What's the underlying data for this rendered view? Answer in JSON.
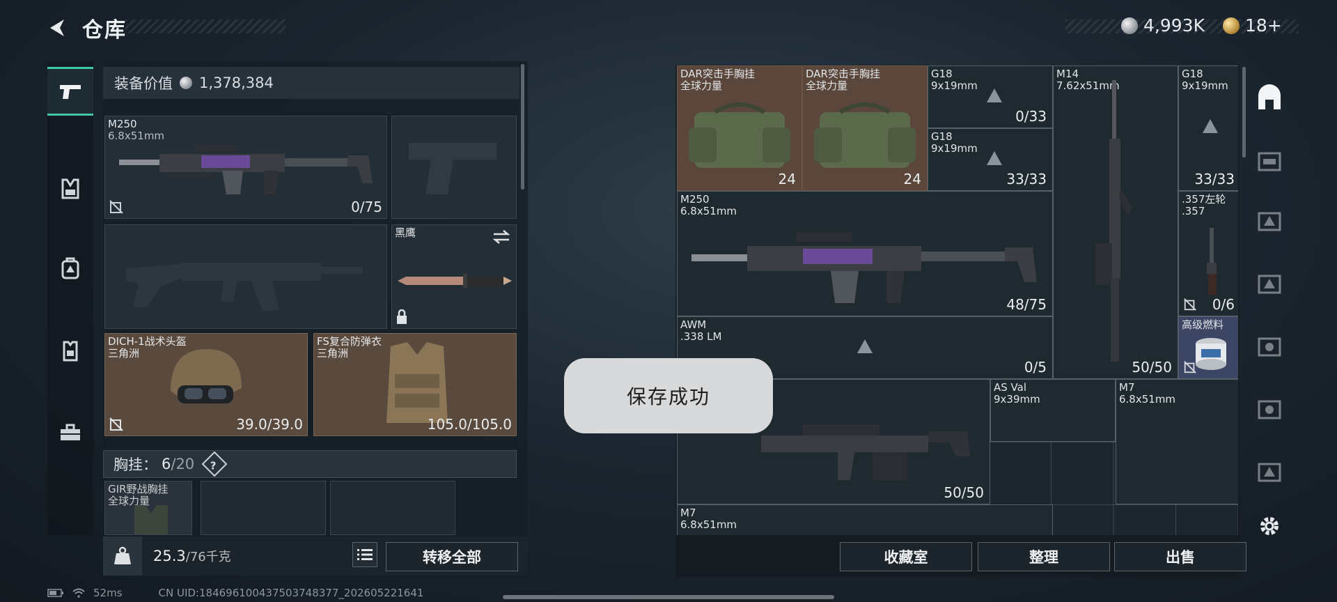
{
  "header": {
    "title": "仓库",
    "currency": [
      {
        "name": "silver",
        "value": "4,993K"
      },
      {
        "name": "gold",
        "value": "18+"
      }
    ]
  },
  "categories": [
    {
      "name": "weapons",
      "icon": "pistol-icon",
      "active": true
    },
    {
      "name": "chest-rig",
      "icon": "chest-rig-icon"
    },
    {
      "name": "backpack",
      "icon": "backpack-icon"
    },
    {
      "name": "armor",
      "icon": "vest-icon"
    },
    {
      "name": "tools",
      "icon": "toolbox-icon"
    }
  ],
  "loadout": {
    "value_label": "装备价值",
    "value": "1,378,384",
    "primary": {
      "name": "M250",
      "caliber": "6.8x51mm",
      "count": "0/75"
    },
    "knife": {
      "name": "黑鹰"
    },
    "helmet": {
      "name": "DICH-1战术头盔",
      "sub": "三角洲",
      "durability": "39.0/39.0"
    },
    "vest": {
      "name": "FS复合防弹衣",
      "sub": "三角洲",
      "durability": "105.0/105.0"
    },
    "chest": {
      "label": "胸挂：",
      "used": "6",
      "total": "/20",
      "help": "?"
    },
    "chest_item": {
      "name": "GIR野战胸挂",
      "sub": "全球力量"
    },
    "weight": {
      "current": "25.3",
      "max": "/76千克"
    },
    "transfer_all": "转移全部"
  },
  "stash": {
    "items": [
      {
        "id": "dar1",
        "name": "DAR突击手胸挂",
        "sub": "全球力量",
        "count": "24"
      },
      {
        "id": "dar2",
        "name": "DAR突击手胸挂",
        "sub": "全球力量",
        "count": "24"
      },
      {
        "id": "g18a",
        "name": "G18",
        "sub": "9x19mm",
        "count": "0/33"
      },
      {
        "id": "m14",
        "name": "M14",
        "sub": "7.62x51mm",
        "count": "50/50"
      },
      {
        "id": "g18c",
        "name": "G18",
        "sub": "9x19mm",
        "count": "33/33"
      },
      {
        "id": "g18b",
        "name": "G18",
        "sub": "9x19mm",
        "count": "33/33"
      },
      {
        "id": "m250",
        "name": "M250",
        "sub": "6.8x51mm",
        "count": "48/75"
      },
      {
        "id": "revolver",
        "name": ".357左轮",
        "sub": ".357",
        "count": "0/6"
      },
      {
        "id": "awm",
        "name": "AWM",
        "sub": ".338 LM",
        "count": "0/5"
      },
      {
        "id": "fuel",
        "name": "高级燃料",
        "sub": ""
      },
      {
        "id": "lmg",
        "name": "",
        "sub": "",
        "count": "50/50"
      },
      {
        "id": "asval",
        "name": "AS Val",
        "sub": "9x39mm"
      },
      {
        "id": "m7a",
        "name": "M7",
        "sub": "6.8x51mm"
      },
      {
        "id": "m7b",
        "name": "M7",
        "sub": "6.8x51mm"
      }
    ],
    "buttons": {
      "collection": "收藏室",
      "sort": "整理",
      "sell": "出售"
    }
  },
  "toast": "保存成功",
  "status": {
    "ping": "52ms",
    "uid": "CN UID:1846961004375037483​77_202605221641"
  }
}
